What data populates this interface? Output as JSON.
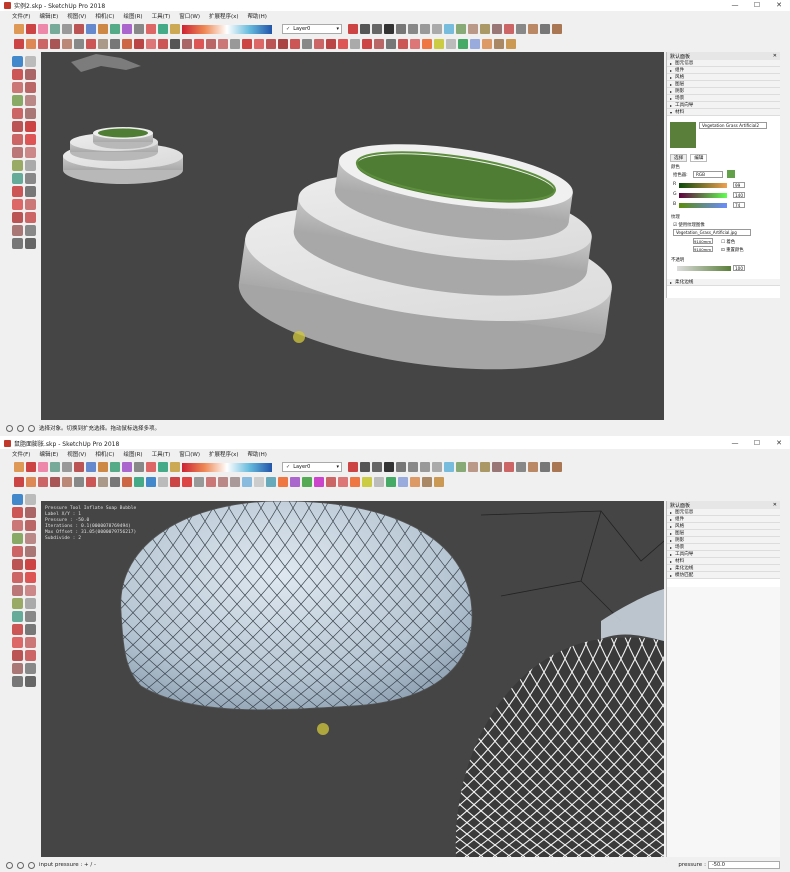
{
  "window1": {
    "title": "实例2.skp - SketchUp Pro 2018",
    "menus": [
      "文件(F)",
      "编辑(E)",
      "视图(V)",
      "相机(C)",
      "绘图(R)",
      "工具(T)",
      "窗口(W)",
      "扩展程序(x)",
      "帮助(H)"
    ],
    "layer": "Layer0",
    "status_text": "选择对象。切换到扩充选择。拖动鼠标选择多项。",
    "tray": {
      "title": "默认面板",
      "rows": [
        "图元信息",
        "组件",
        "风格",
        "图层",
        "阴影",
        "场景",
        "工具向导",
        "材料"
      ],
      "material_name": "Vegetation Grass Artificial2",
      "tab_select": "选择",
      "tab_edit": "编辑",
      "color_heading": "颜色",
      "picker_label": "拾色器:",
      "picker_value": "RGB",
      "r_value": "99",
      "g_value": "140",
      "b_value": "74",
      "texture_heading": "纹理",
      "use_texture": "使用纹理图像",
      "texture_file": "Vegetation_Grass_Artificial.jpg",
      "width": "9100mm",
      "height": "9100mm",
      "colorize": "着色",
      "reset_color": "重置颜色",
      "opacity_heading": "不透明",
      "opacity_value": "100",
      "collapsed_row": "柔化边线"
    }
  },
  "window2": {
    "title": "鼠脂面膨胀.skp - SketchUp Pro 2018",
    "menus": [
      "文件(F)",
      "编辑(E)",
      "视图(V)",
      "相机(C)",
      "绘图(R)",
      "工具(T)",
      "窗口(W)",
      "扩展程序(x)",
      "帮助(H)"
    ],
    "layer": "Layer0",
    "overlay_text": [
      "Pressure Tool  Inflate Soap Bubble",
      "Label X/Y  : 1",
      "Pressure   : -50.0",
      "Iterations : 0.1(0000078769494)",
      "Max Offset : 31.05(0000079756217)",
      "Subdivide  : 2"
    ],
    "status_text": "input pressure : + / -",
    "pressure_label": "pressure",
    "pressure_value": "-50.0",
    "tray": {
      "title": "默认面板",
      "rows": [
        "图元信息",
        "组件",
        "风格",
        "图层",
        "阴影",
        "场景",
        "工具向导",
        "材料",
        "柔化边线",
        "模仿匹配"
      ]
    }
  }
}
